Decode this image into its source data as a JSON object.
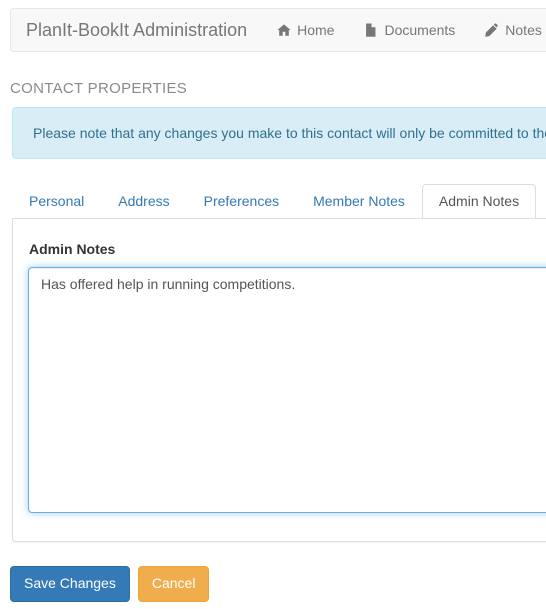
{
  "navbar": {
    "brand": "PlanIt-BookIt Administration",
    "links": [
      {
        "label": "Home",
        "icon": "home-icon"
      },
      {
        "label": "Documents",
        "icon": "document-icon"
      },
      {
        "label": "Notes",
        "icon": "pencil-icon"
      }
    ]
  },
  "page": {
    "heading": "CONTACT PROPERTIES",
    "alert": {
      "text": "Please note that any changes you make to this contact will only be committed to the",
      "bg_color": "#d9edf7",
      "text_color": "#31708f"
    }
  },
  "tabs": [
    {
      "label": "Personal",
      "active": false
    },
    {
      "label": "Address",
      "active": false
    },
    {
      "label": "Preferences",
      "active": false
    },
    {
      "label": "Member Notes",
      "active": false
    },
    {
      "label": "Admin Notes",
      "active": true
    }
  ],
  "panel": {
    "field_label": "Admin Notes",
    "textarea_value": "Has offered help in running competitions.",
    "textarea_placeholder": ""
  },
  "buttons": {
    "save_label": "Save Changes",
    "cancel_label": "Cancel",
    "save_color": "#337ab7",
    "cancel_color": "#f0ad4e"
  }
}
